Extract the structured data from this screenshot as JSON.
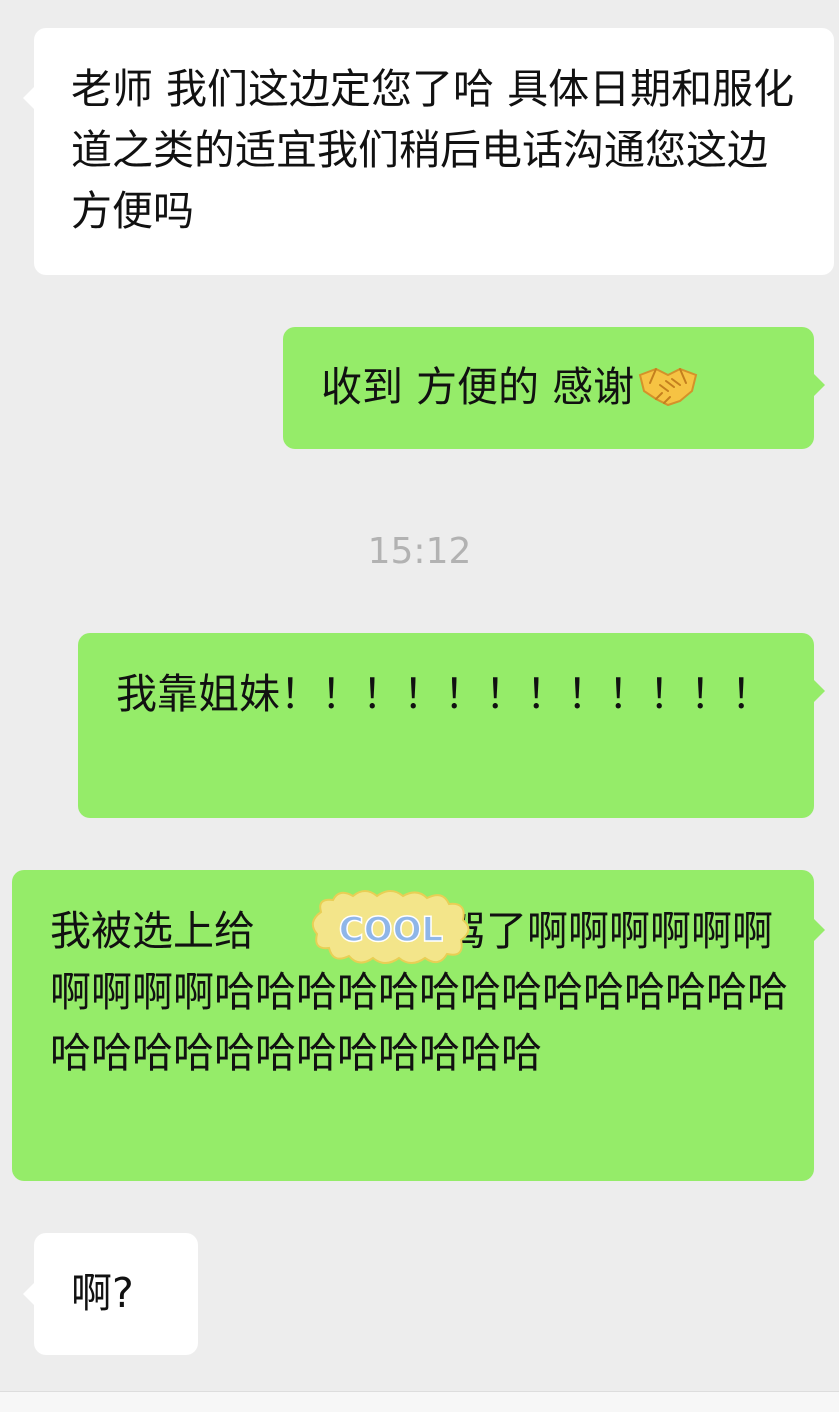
{
  "chat": {
    "messages": [
      {
        "side": "incoming",
        "text": "老师 我们这边定您了哈 具体日期和服化道之类的适宜我们稍后电话沟通您这边方便吗"
      },
      {
        "side": "outgoing",
        "text": "收到 方便的 感谢",
        "emoji": "handshake-emoji"
      },
      {
        "side": "outgoing",
        "text": "我靠姐妹！！！！！！！！！！！！"
      },
      {
        "side": "outgoing",
        "text": "我被选上给",
        "text_after_sticker": "伴驾了啊啊啊啊啊啊啊啊啊啊哈哈哈哈哈哈哈哈哈哈哈哈哈哈哈哈哈哈哈哈哈哈哈哈哈哈",
        "sticker": {
          "name": "cool-sticker",
          "text": "COOL"
        }
      },
      {
        "side": "incoming",
        "text": "啊?"
      }
    ],
    "timestamp": "15:12"
  },
  "colors": {
    "background": "#ededed",
    "incoming_bubble": "#ffffff",
    "outgoing_bubble": "#95ec69",
    "timestamp_text": "#b2b2b2"
  }
}
